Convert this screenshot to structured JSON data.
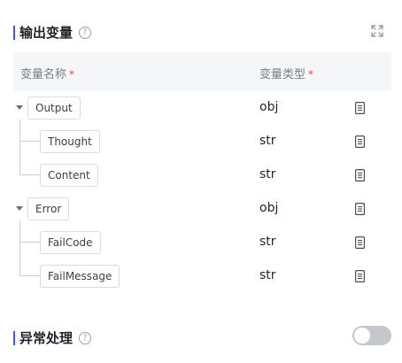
{
  "output_section": {
    "title": "输出变量",
    "help_icon": "help-circle-icon",
    "expand_icon": "fullscreen-expand-icon"
  },
  "table": {
    "col_name": "变量名称",
    "col_type": "变量类型",
    "required_mark": "*",
    "rows": [
      {
        "name": "Output",
        "type": "obj",
        "level": 0
      },
      {
        "name": "Thought",
        "type": "str",
        "level": 1
      },
      {
        "name": "Content",
        "type": "str",
        "level": 1
      },
      {
        "name": "Error",
        "type": "obj",
        "level": 0
      },
      {
        "name": "FailCode",
        "type": "str",
        "level": 1
      },
      {
        "name": "FailMessage",
        "type": "str",
        "level": 1
      }
    ]
  },
  "exception_section": {
    "title": "异常处理",
    "help_icon": "help-circle-icon",
    "toggle_on": false
  },
  "colors": {
    "accent_bar": "#3b5bdb",
    "required": "#e54545",
    "toggle_off": "#c4c7cc"
  }
}
